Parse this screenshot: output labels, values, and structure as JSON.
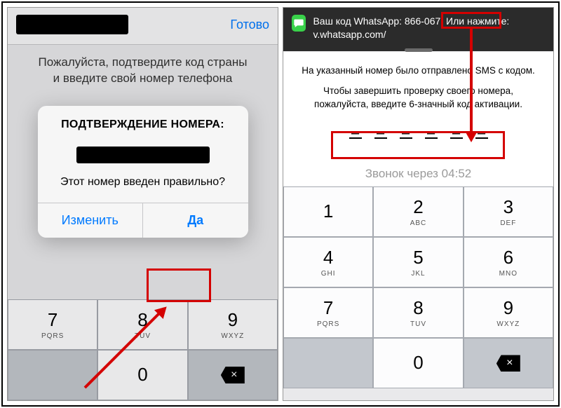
{
  "left": {
    "header_done": "Готово",
    "body_line1": "Пожалуйста, подтвердите код страны",
    "body_line2": "и введите свой номер телефона",
    "dialog": {
      "title": "ПОДТВЕРЖДЕНИЕ НОМЕРА:",
      "message": "Этот номер введен правильно?",
      "btn_change": "Изменить",
      "btn_yes": "Да"
    },
    "keys": [
      {
        "d": "7",
        "l": "PQRS"
      },
      {
        "d": "8",
        "l": "TUV"
      },
      {
        "d": "9",
        "l": "WXYZ"
      },
      {
        "d": "",
        "l": ""
      },
      {
        "d": "0",
        "l": ""
      },
      {
        "d": "",
        "l": ""
      }
    ]
  },
  "right": {
    "notif_text_prefix": "Ваш код WhatsApp: ",
    "notif_code": "866-067",
    "notif_text_suffix": ". Или нажмите: v.whatsapp.com/",
    "body_line1": "На указанный номер было отправлено SMS с кодом.",
    "body_line2": "Чтобы завершить проверку своего номера, пожалуйста, введите 6-значный код активации.",
    "code_placeholders": [
      "–",
      "–",
      "–",
      "–",
      "–",
      "–"
    ],
    "call_text": "Звонок через 04:52",
    "keys": [
      {
        "d": "1",
        "l": ""
      },
      {
        "d": "2",
        "l": "ABC"
      },
      {
        "d": "3",
        "l": "DEF"
      },
      {
        "d": "4",
        "l": "GHI"
      },
      {
        "d": "5",
        "l": "JKL"
      },
      {
        "d": "6",
        "l": "MNO"
      },
      {
        "d": "7",
        "l": "PQRS"
      },
      {
        "d": "8",
        "l": "TUV"
      },
      {
        "d": "9",
        "l": "WXYZ"
      },
      {
        "d": "",
        "l": ""
      },
      {
        "d": "0",
        "l": ""
      },
      {
        "d": "",
        "l": ""
      }
    ]
  },
  "colors": {
    "accent": "#007aff",
    "highlight": "#d40000"
  }
}
